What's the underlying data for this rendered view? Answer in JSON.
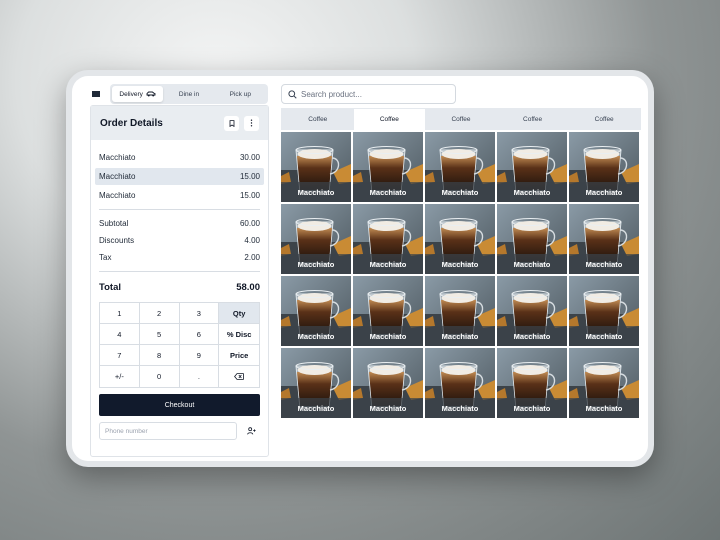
{
  "header": {
    "order_types": [
      {
        "label": "Delivery",
        "icon": "car-icon",
        "active": true
      },
      {
        "label": "Dine in",
        "active": false
      },
      {
        "label": "Pick up",
        "active": false
      }
    ],
    "search_placeholder": "Search product..."
  },
  "order": {
    "title": "Order Details",
    "items": [
      {
        "name": "Macchiato",
        "price": "30.00",
        "selected": false
      },
      {
        "name": "Macchiato",
        "price": "15.00",
        "selected": true
      },
      {
        "name": "Macchiato",
        "price": "15.00",
        "selected": false
      }
    ],
    "summary": {
      "subtotal_label": "Subtotal",
      "subtotal": "60.00",
      "discounts_label": "Discounts",
      "discounts": "4.00",
      "tax_label": "Tax",
      "tax": "2.00"
    },
    "total_label": "Total",
    "total": "58.00",
    "keypad": [
      "1",
      "2",
      "3",
      "Qty",
      "4",
      "5",
      "6",
      "% Disc",
      "7",
      "8",
      "9",
      "Price",
      "+/-",
      "0",
      ".",
      "⌫"
    ],
    "checkout_label": "Checkout",
    "phone_placeholder": "Phone number"
  },
  "categories": [
    {
      "label": "Coffee",
      "active": false
    },
    {
      "label": "Coffee",
      "active": true
    },
    {
      "label": "Coffee",
      "active": false
    },
    {
      "label": "Coffee",
      "active": false
    },
    {
      "label": "Coffee",
      "active": false
    }
  ],
  "products": [
    "Macchiato",
    "Macchiato",
    "Macchiato",
    "Macchiato",
    "Macchiato",
    "Macchiato",
    "Macchiato",
    "Macchiato",
    "Macchiato",
    "Macchiato",
    "Macchiato",
    "Macchiato",
    "Macchiato",
    "Macchiato",
    "Macchiato",
    "Macchiato",
    "Macchiato",
    "Macchiato",
    "Macchiato",
    "Macchiato"
  ],
  "colors": {
    "accent_dark": "#111a2c",
    "selected_row": "#e1e7ee",
    "panel_header": "#e9edf1"
  }
}
